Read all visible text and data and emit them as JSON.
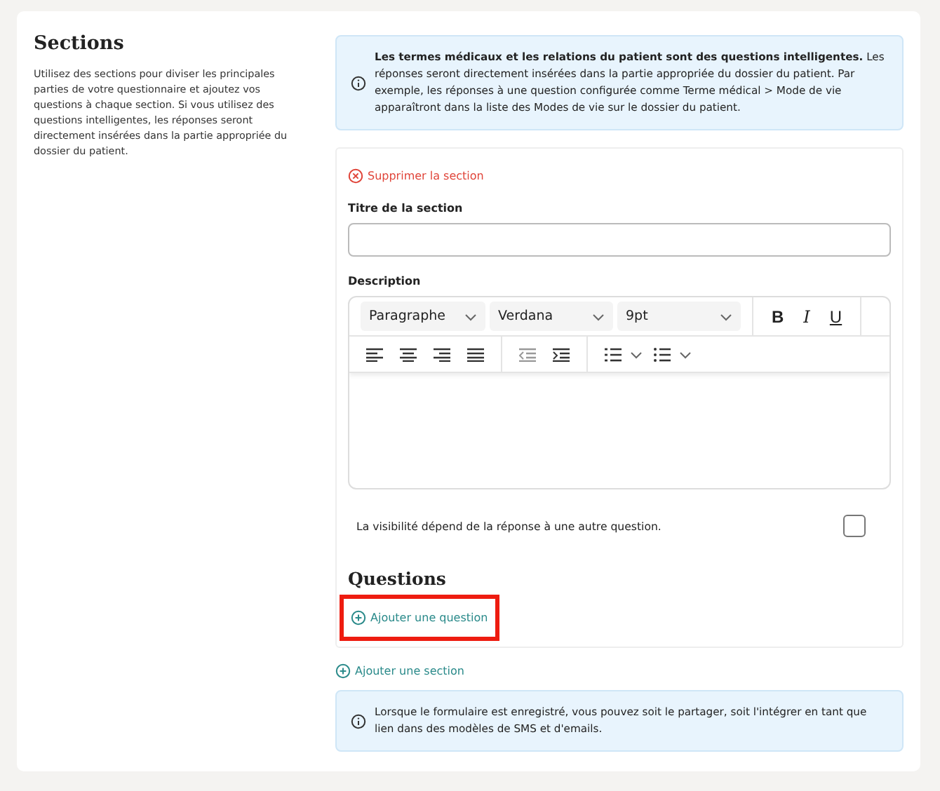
{
  "intro": {
    "title": "Sections",
    "text": "Utilisez des sections pour diviser les principales parties de votre questionnaire et ajoutez vos questions à chaque section. Si vous utilisez des questions intelligentes, les réponses seront directement insérées dans la partie appropriée du dossier du patient."
  },
  "info_top": "**Les termes médicaux et les relations du patient sont des questions intelligentes.**   Les réponses seront directement insérées dans la partie appropriée du dossier du patient. Par exemple, les réponses à une question configurée comme Terme médical > Mode de vie apparaîtront dans la liste des Modes de vie sur le dossier du patient.",
  "section": {
    "delete_link": "Supprimer la section",
    "title_label": "Titre de la section",
    "description_label": "Description",
    "editor": {
      "dropdowns": [
        {
          "value": "Paragraphe"
        },
        {
          "value": "Verdana"
        },
        {
          "value": "9pt"
        }
      ],
      "format_buttons": [
        "B",
        "I",
        "U"
      ]
    },
    "visibility": {
      "label": "La visibilité dépend de la réponse à une autre question.",
      "checked": false
    },
    "questions_heading": "Questions",
    "add_question": {
      "label": "Ajouter une question",
      "highlighted": true
    }
  },
  "add_section": "Ajouter une section",
  "info_bottom": "Lorsque le formulaire est enregistré, vous pouvez soit le partager, soit l'intégrer en tant que lien dans des modèles de SMS et d'emails."
}
